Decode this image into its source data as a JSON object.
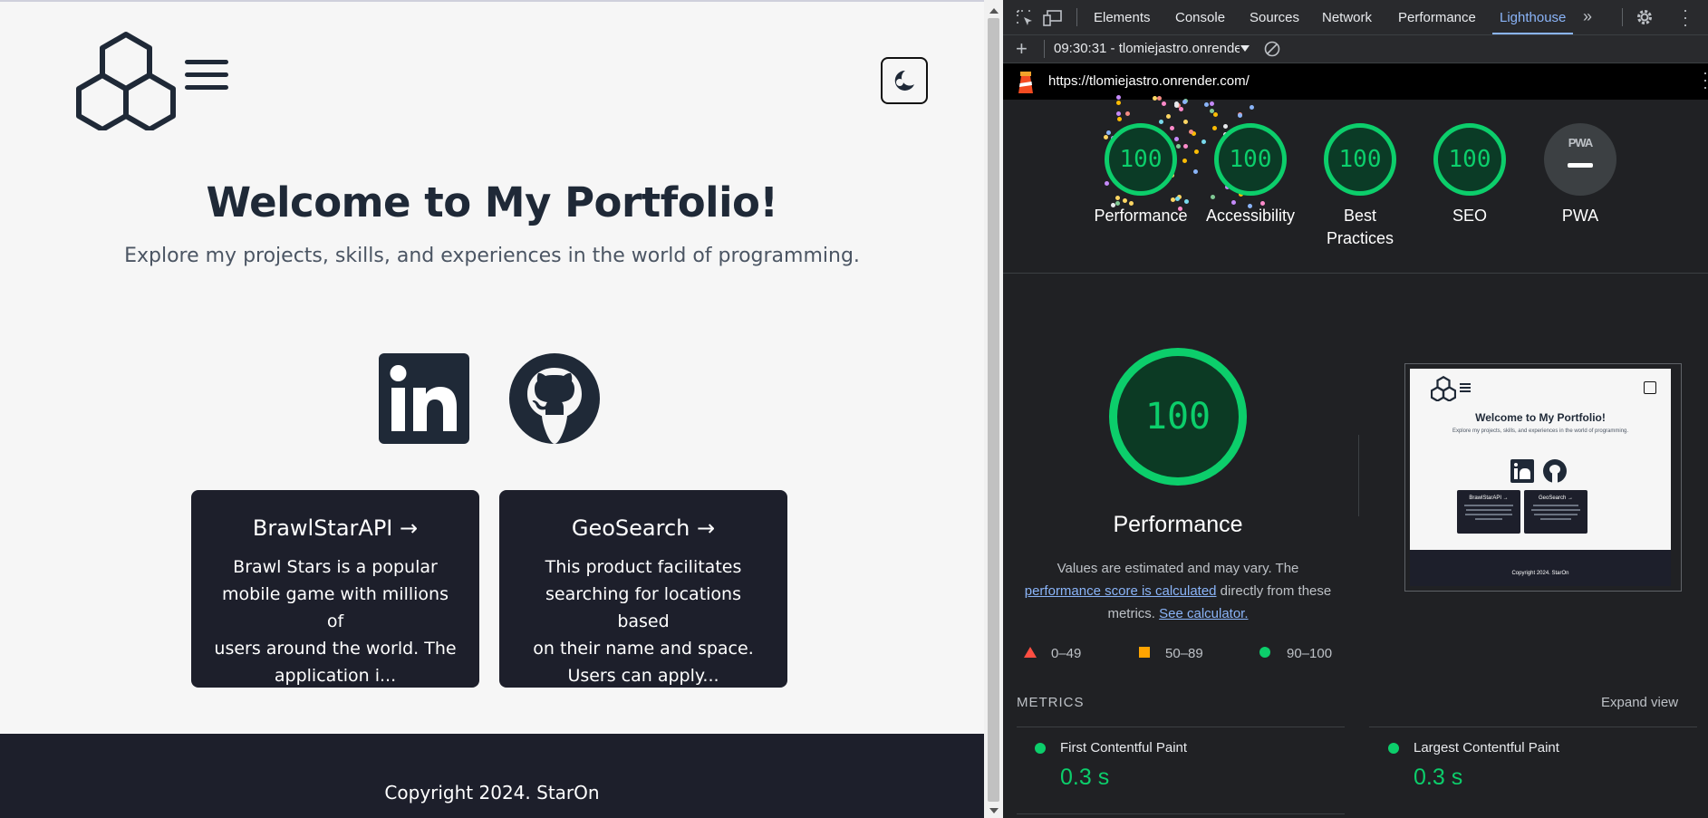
{
  "page": {
    "title": "Welcome to My Portfolio!",
    "subtitle": "Explore my projects, skills, and experiences in the world of programming.",
    "cards": [
      {
        "title": "BrawlStarAPI →",
        "lines": [
          "Brawl Stars is a popular",
          "mobile game with millions of",
          "users around the world. The",
          "application i..."
        ]
      },
      {
        "title": "GeoSearch →",
        "lines": [
          "This product facilitates",
          "searching for locations based",
          "on their name and space.",
          "Users can apply..."
        ]
      }
    ],
    "footer": "Copyright 2024. StarOn"
  },
  "devtools": {
    "tabs": [
      "Elements",
      "Console",
      "Sources",
      "Network",
      "Performance",
      "Lighthouse"
    ],
    "active_tab": "Lighthouse",
    "report_selector": "09:30:31 - tlomiejastro.onrendе",
    "url": "https://tlomiejastro.onrender.com/",
    "scores": [
      {
        "label": "Performance",
        "value": "100"
      },
      {
        "label": "Accessibility",
        "value": "100"
      },
      {
        "label": "Best",
        "label2": "Practices",
        "value": "100"
      },
      {
        "label": "SEO",
        "value": "100"
      }
    ],
    "pwa": {
      "label": "PWA",
      "badge": "PWA"
    },
    "main_score": "100",
    "main_title": "Performance",
    "note_line1": "Values are estimated and may vary. The",
    "note_link1": "performance score is calculated",
    "note_mid": " directly from these",
    "note_line3a": "metrics. ",
    "note_link2": "See calculator.",
    "legend": [
      "0–49",
      "50–89",
      "90–100"
    ],
    "metrics_label": "METRICS",
    "expand_view": "Expand view",
    "metrics": [
      {
        "name": "First Contentful Paint",
        "value": "0.3 s"
      },
      {
        "name": "Largest Contentful Paint",
        "value": "0.3 s"
      }
    ],
    "thumbnail": {
      "title": "Welcome to My Portfolio!",
      "subtitle": "Explore my projects, skills, and experiences in the world of programming.",
      "cards": [
        "BrawlStarAPI →",
        "GeoSearch →"
      ],
      "footer": "Copyright 2024. StarOn"
    },
    "colors": {
      "pass": "#0cce6b",
      "average": "#ffa400",
      "fail": "#ff4e42",
      "link": "#8ab4f8"
    }
  }
}
